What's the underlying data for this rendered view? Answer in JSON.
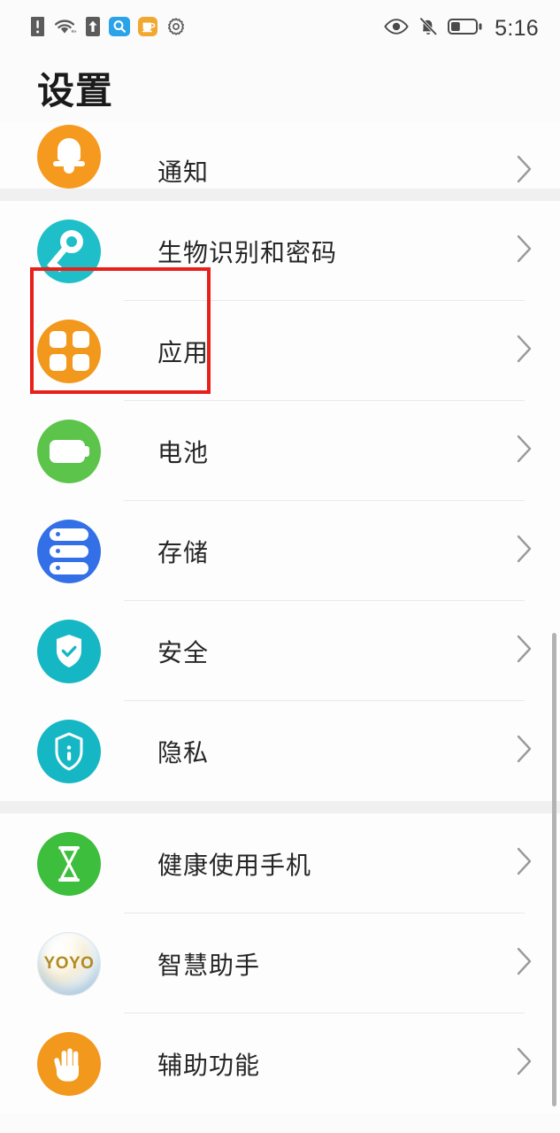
{
  "status_bar": {
    "left_icons": [
      {
        "name": "sim-alert-icon",
        "glyph": "sim-alert"
      },
      {
        "name": "wifi-icon",
        "glyph": "wifi"
      },
      {
        "name": "upload-arrow-icon",
        "glyph": "upload"
      },
      {
        "name": "search-app-icon",
        "glyph": "search",
        "color": "#2BA3E8"
      },
      {
        "name": "cup-app-icon",
        "glyph": "cup",
        "color": "#F0A830"
      },
      {
        "name": "gear-icon",
        "glyph": "gear"
      }
    ],
    "right_icons": [
      {
        "name": "eye-comfort-icon",
        "glyph": "eye"
      },
      {
        "name": "bell-muted-icon",
        "glyph": "bell-off"
      },
      {
        "name": "battery-icon",
        "glyph": "battery",
        "level_percent": 35
      }
    ],
    "time": "5:16"
  },
  "header": {
    "title": "设置"
  },
  "annotation": {
    "color": "#e8201a",
    "target": "应用"
  },
  "settings": {
    "groups": [
      {
        "id": "group-notifications",
        "rows": [
          {
            "id": "notifications",
            "label": "通知",
            "icon_name": "bell-icon",
            "icon_color": "#F59A1E",
            "clipped": true,
            "divider": false
          }
        ]
      },
      {
        "id": "group-system",
        "rows": [
          {
            "id": "biometrics-password",
            "label": "生物识别和密码",
            "icon_name": "key-icon",
            "icon_color": "#1EBFC9",
            "clipped": false,
            "divider": true
          },
          {
            "id": "apps",
            "label": "应用",
            "icon_name": "apps-grid-icon",
            "icon_color": "#F2981C",
            "clipped": false,
            "divider": true
          },
          {
            "id": "battery",
            "label": "电池",
            "icon_name": "battery-icon",
            "icon_color": "#5CC44A",
            "clipped": false,
            "divider": true
          },
          {
            "id": "storage",
            "label": "存储",
            "icon_name": "storage-disks-icon",
            "icon_color": "#3370E8",
            "clipped": false,
            "divider": true
          },
          {
            "id": "security",
            "label": "安全",
            "icon_name": "shield-check-icon",
            "icon_color": "#16B7C4",
            "clipped": false,
            "divider": true
          },
          {
            "id": "privacy",
            "label": "隐私",
            "icon_name": "shield-info-icon",
            "icon_color": "#16B7C4",
            "clipped": false,
            "divider": false
          }
        ]
      },
      {
        "id": "group-wellbeing",
        "rows": [
          {
            "id": "digital-balance",
            "label": "健康使用手机",
            "icon_name": "hourglass-icon",
            "icon_color": "#3DBE3D",
            "clipped": false,
            "divider": true
          },
          {
            "id": "smart-assistant",
            "label": "智慧助手",
            "icon_name": "yoyo-pearl-icon",
            "icon_color": "#DCE9F1",
            "icon_text": "YOYO",
            "clipped": false,
            "divider": true
          },
          {
            "id": "accessibility",
            "label": "辅助功能",
            "icon_name": "hand-icon",
            "icon_color": "#F2981C",
            "clipped": false,
            "divider": false
          }
        ]
      }
    ]
  },
  "chevron_glyph": "›"
}
